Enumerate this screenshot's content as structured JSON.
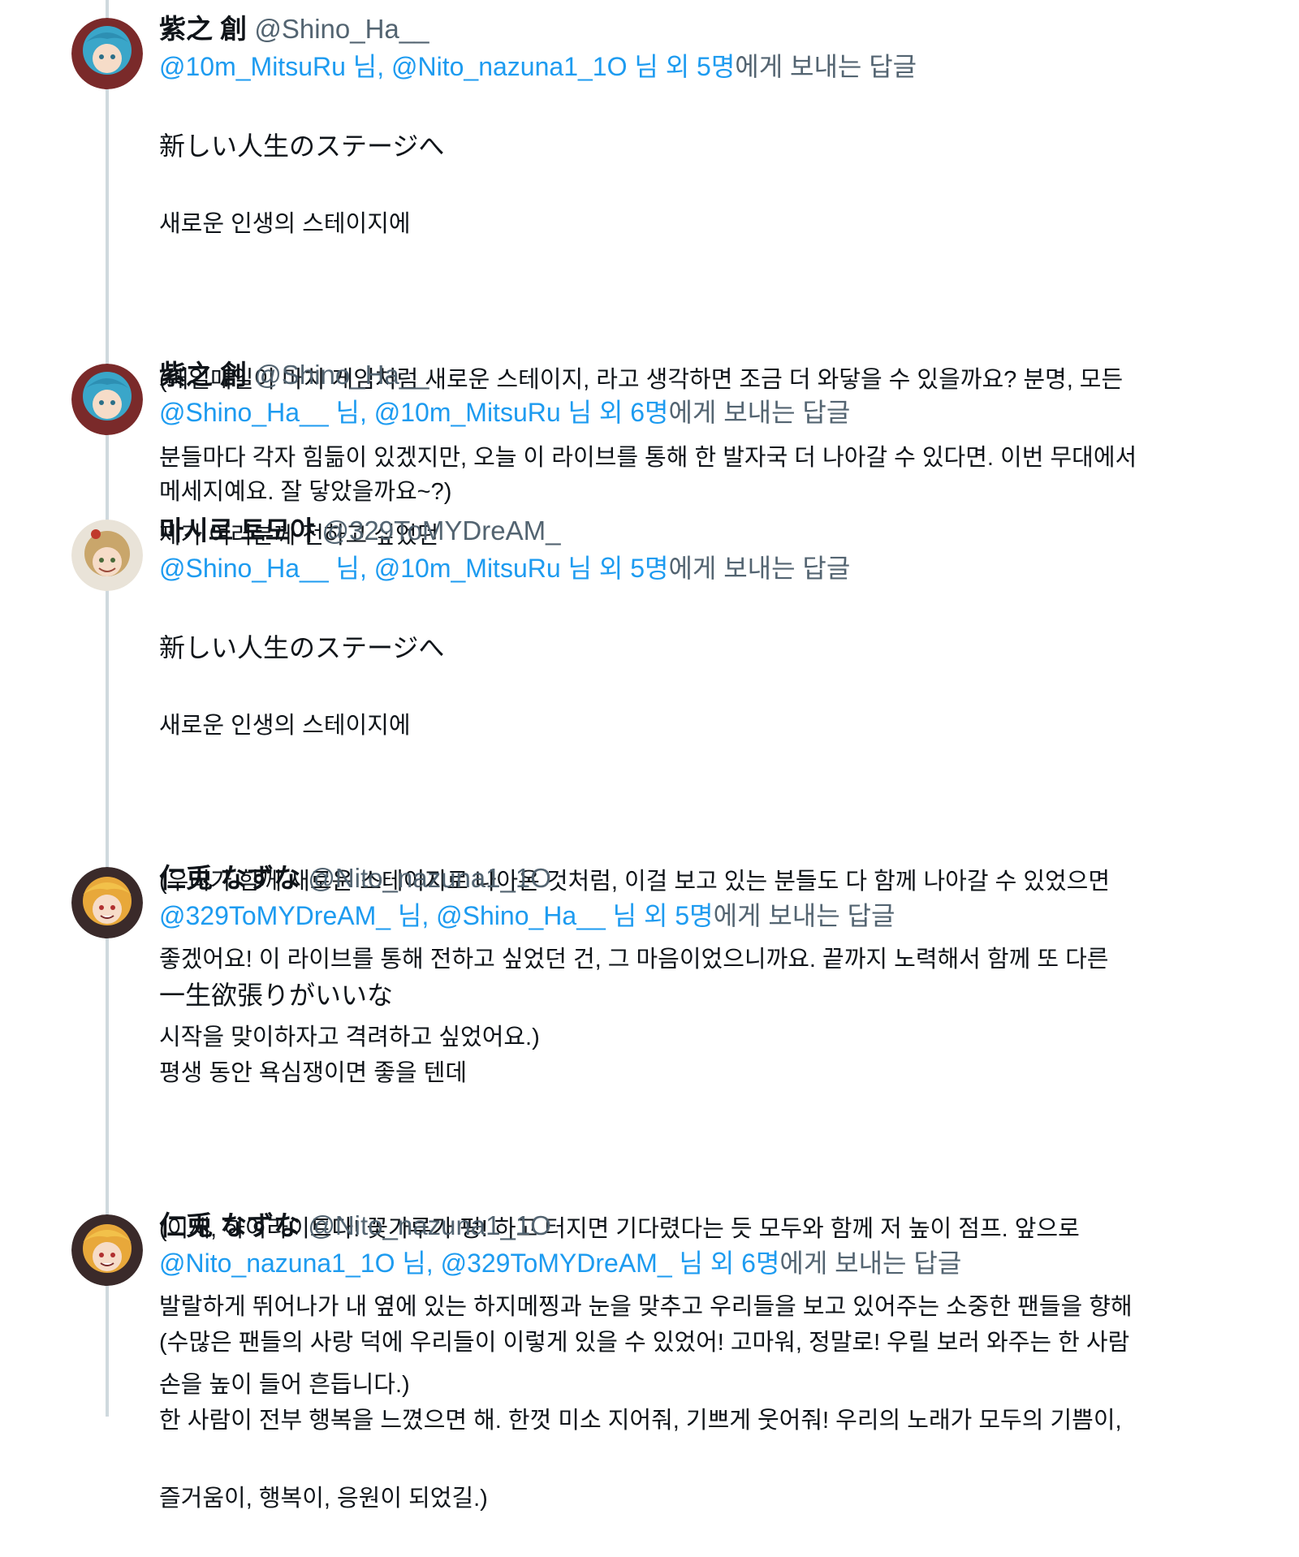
{
  "tweets": [
    {
      "display_name": "紫之 創",
      "handle": "@Shino_Ha__",
      "reply_mentions_1": "@10m_MitsuRu",
      "reply_sep": " 님, ",
      "reply_mentions_2": "@Nito_nazuna1_1O",
      "reply_suffix_link": " 님 외 5명",
      "reply_suffix": "에게 보내는 답글",
      "lines": [
        "新しい人生のステージへ",
        "새로운 인생의 스테이지에",
        "",
        "(매일매일이 마치 게임처럼 새로운 스테이지, 라고 생각하면 조금 더 와닿을 수 있을까요? 분명, 모든",
        "분들마다 각자 힘듦이 있겠지만, 오늘 이 라이브를 통해 한 발자국 더 나아갈 수 있다면. 이번 무대에서",
        "제가 여러분께 전하고 싶었던"
      ],
      "avatar_color": "#3aa6c9"
    },
    {
      "display_name": "紫之 創",
      "handle": "@Shino_Ha__",
      "reply_mentions_1": "@Shino_Ha__",
      "reply_sep": " 님, ",
      "reply_mentions_2": "@10m_MitsuRu",
      "reply_suffix_link": " 님 외 6명",
      "reply_suffix": "에게 보내는 답글",
      "lines": [
        "메세지예요. 잘 닿았을까요~?)"
      ],
      "avatar_color": "#3aa6c9"
    },
    {
      "display_name": "마시로 토모야",
      "handle": "@329ToMYDreAM_",
      "reply_mentions_1": "@Shino_Ha__",
      "reply_sep": " 님, ",
      "reply_mentions_2": "@10m_MitsuRu",
      "reply_suffix_link": " 님 외 5명",
      "reply_suffix": "에게 보내는 답글",
      "lines": [
        "新しい人生のステージへ",
        "새로운 인생의 스테이지에",
        "",
        "(우리가 함께 새로운 스테이지로 나아온 것처럼, 이걸 보고 있는 분들도 다 함께 나아갈 수 있었으면",
        "좋겠어요! 이 라이브를 통해 전하고 싶었던 건, 그 마음이었으니까요. 끝까지 노력해서 함께 또 다른",
        "시작을 맞이하자고 격려하고 싶었어요.)"
      ],
      "avatar_color": "#c9a66b"
    },
    {
      "display_name": "仁兎 なずな",
      "handle": "@Nito_nazuna1_1O",
      "reply_mentions_1": "@329ToMYDreAM_",
      "reply_sep": " 님, ",
      "reply_mentions_2": "@Shino_Ha__",
      "reply_suffix_link": " 님 외 5명",
      "reply_suffix": "에게 보내는 답글",
      "lines": [
        "一生欲張りがいいな",
        "평생 동안 욕심쟁이면 좋을 텐데",
        "",
        "(이제, 하이라이트다! 꽃가루가 펑! 하고 터지면 기다렸다는 듯 모두와 함께 저 높이 점프. 앞으로",
        "발랄하게 뛰어나가 내 옆에 있는 하지메찡과 눈을 맞추고 우리들을 보고 있어주는 소중한 팬들을 향해",
        "손을 높이 들어 흔듭니다.)"
      ],
      "avatar_color": "#e8a83a"
    },
    {
      "display_name": "仁兎 なずな",
      "handle": "@Nito_nazuna1_1O",
      "reply_mentions_1": "@Nito_nazuna1_1O",
      "reply_sep": " 님, ",
      "reply_mentions_2": "@329ToMYDreAM_",
      "reply_suffix_link": " 님 외 6명",
      "reply_suffix": "에게 보내는 답글",
      "lines": [
        "(수많은 팬들의 사랑 덕에 우리들이 이렇게 있을 수 있었어! 고마워, 정말로! 우릴 보러 와주는 한 사람",
        "한 사람이 전부 행복을 느꼈으면 해. 한껏 미소 지어줘, 기쁘게 웃어줘! 우리의 노래가 모두의 기쁨이,",
        "즐거움이, 행복이, 응원이 되었길.)"
      ],
      "avatar_color": "#e8a83a"
    }
  ]
}
